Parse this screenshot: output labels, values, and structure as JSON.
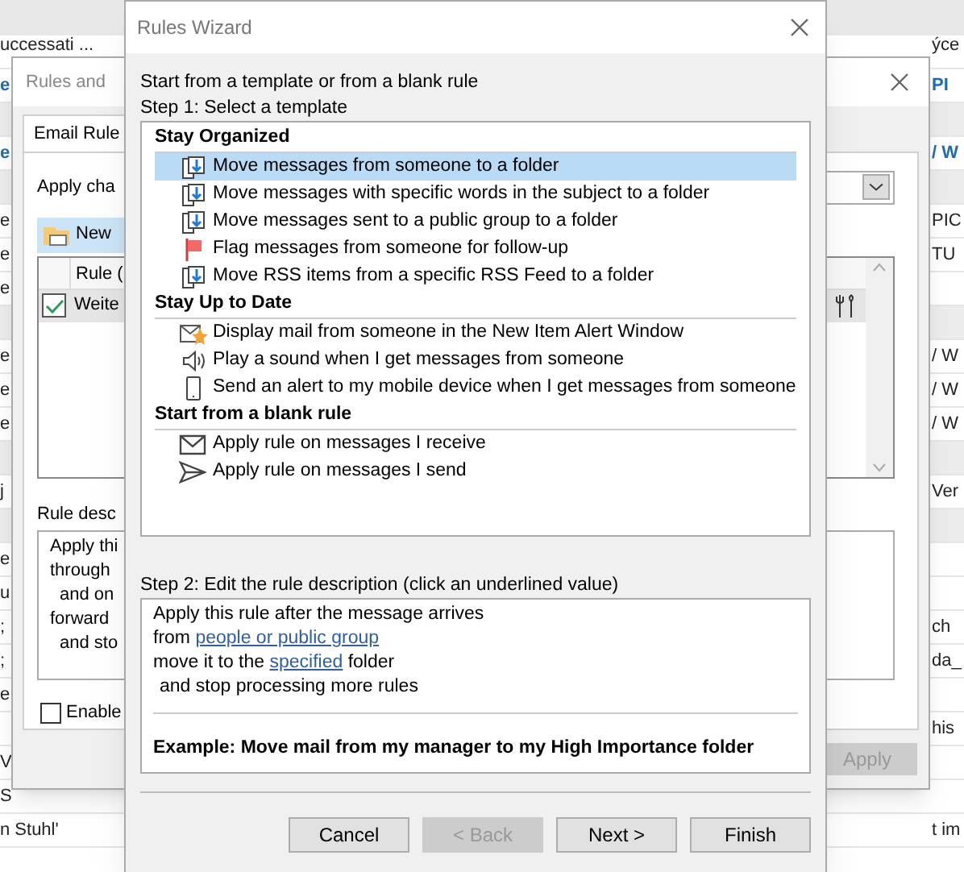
{
  "outlook": {
    "rows": [
      {
        "left": "uccessati ...",
        "right": "ýce",
        "shaded": false,
        "blue": false
      },
      {
        "left": "e",
        "right": "PI",
        "shaded": false,
        "blue": true
      },
      {
        "shaded": true
      },
      {
        "left": "e",
        "right": "/ W",
        "shaded": false,
        "blue": true
      },
      {
        "shaded": true
      },
      {
        "left": "e",
        "right": "PIC",
        "shaded": false,
        "blue": false
      },
      {
        "left": "e",
        "right": "TU",
        "shaded": false,
        "blue": false
      },
      {
        "left": "e",
        "shaded": false,
        "blue": false
      },
      {
        "shaded": true
      },
      {
        "left": "e",
        "right": "/ W",
        "shaded": false,
        "blue": false
      },
      {
        "left": "e",
        "right": "/ W",
        "shaded": false,
        "blue": false
      },
      {
        "left": "e",
        "right": "/ W",
        "shaded": false,
        "blue": false
      },
      {
        "shaded": true
      },
      {
        "left": "j",
        "right": "Ver",
        "shaded": false,
        "blue": false
      },
      {
        "shaded": true
      },
      {
        "left": "e",
        "shaded": false,
        "blue": false
      },
      {
        "left": "u",
        "shaded": false,
        "blue": false
      },
      {
        "left": ";",
        "right": "ch",
        "shaded": false,
        "blue": false
      },
      {
        "left": ";",
        "right": "da_",
        "shaded": false,
        "blue": false
      },
      {
        "left": "e",
        "shaded": false,
        "blue": false
      },
      {
        "right": "his",
        "shaded": false,
        "blue": false
      },
      {
        "left": "V",
        "shaded": false,
        "blue": false
      },
      {
        "left": "S",
        "shaded": false,
        "blue": false
      },
      {
        "left": "n Stuhl'",
        "right": "t im",
        "shaded": false,
        "blue": false
      }
    ]
  },
  "rules_and_alerts": {
    "title": "Rules and",
    "tab": "Email Rule",
    "apply_changes_label": "Apply cha",
    "new_rule_button": "New",
    "column": "Rule (",
    "rules": [
      {
        "name": "Weite",
        "enabled": true,
        "selected": true
      }
    ],
    "description_label": "Rule desc",
    "description_lines": [
      {
        "text": "Apply thi",
        "kind": "line"
      },
      {
        "text": "through",
        "kind": "line"
      },
      {
        "text": "and on",
        "kind": "indent"
      },
      {
        "text": "forward",
        "kind": "line"
      },
      {
        "text": "and sto",
        "kind": "indent"
      }
    ],
    "enable_checkbox": {
      "label": "Enable",
      "checked": false
    },
    "apply_button": {
      "label": "Apply",
      "disabled": true
    }
  },
  "rules_wizard": {
    "title": "Rules Wizard",
    "intro": "Start from a template or from a blank rule",
    "step1": "Step 1: Select a template",
    "template_groups": [
      {
        "heading": "Stay Organized",
        "items": [
          {
            "label": "Move messages from someone to a folder",
            "kind": "move",
            "selected": true
          },
          {
            "label": "Move messages with specific words in the subject to a folder",
            "kind": "move",
            "selected": false
          },
          {
            "label": "Move messages sent to a public group to a folder",
            "kind": "move",
            "selected": false
          },
          {
            "label": "Flag messages from someone for follow-up",
            "kind": "flag",
            "selected": false
          },
          {
            "label": "Move RSS items from a specific RSS Feed to a folder",
            "kind": "move",
            "selected": false
          }
        ]
      },
      {
        "heading": "Stay Up to Date",
        "items": [
          {
            "label": "Display mail from someone in the New Item Alert Window",
            "kind": "alert",
            "selected": false
          },
          {
            "label": "Play a sound when I get messages from someone",
            "kind": "sound",
            "selected": false
          },
          {
            "label": "Send an alert to my mobile device when I get messages from someone",
            "kind": "mobile",
            "selected": false
          }
        ]
      },
      {
        "heading": "Start from a blank rule",
        "items": [
          {
            "label": "Apply rule on messages I receive",
            "kind": "receive",
            "selected": false
          },
          {
            "label": "Apply rule on messages I send",
            "kind": "send",
            "selected": false
          }
        ]
      }
    ],
    "step2": "Step 2: Edit the rule description (click an underlined value)",
    "description": [
      {
        "indent": false,
        "parts": [
          {
            "text": "Apply this rule after the message arrives",
            "link": false
          }
        ]
      },
      {
        "indent": false,
        "parts": [
          {
            "text": "from ",
            "link": false
          },
          {
            "text": "people or public group",
            "link": true
          }
        ]
      },
      {
        "indent": false,
        "parts": [
          {
            "text": "move it to the ",
            "link": false
          },
          {
            "text": "specified",
            "link": true
          },
          {
            "text": " folder",
            "link": false
          }
        ]
      },
      {
        "indent": true,
        "parts": [
          {
            "text": "and stop processing more rules",
            "link": false
          }
        ]
      }
    ],
    "example": "Example: Move mail from my manager to my High Importance folder",
    "buttons": [
      {
        "label": "Cancel",
        "disabled": false
      },
      {
        "label": "< Back",
        "disabled": true
      },
      {
        "label": "Next >",
        "disabled": false
      },
      {
        "label": "Finish",
        "disabled": false
      }
    ]
  }
}
